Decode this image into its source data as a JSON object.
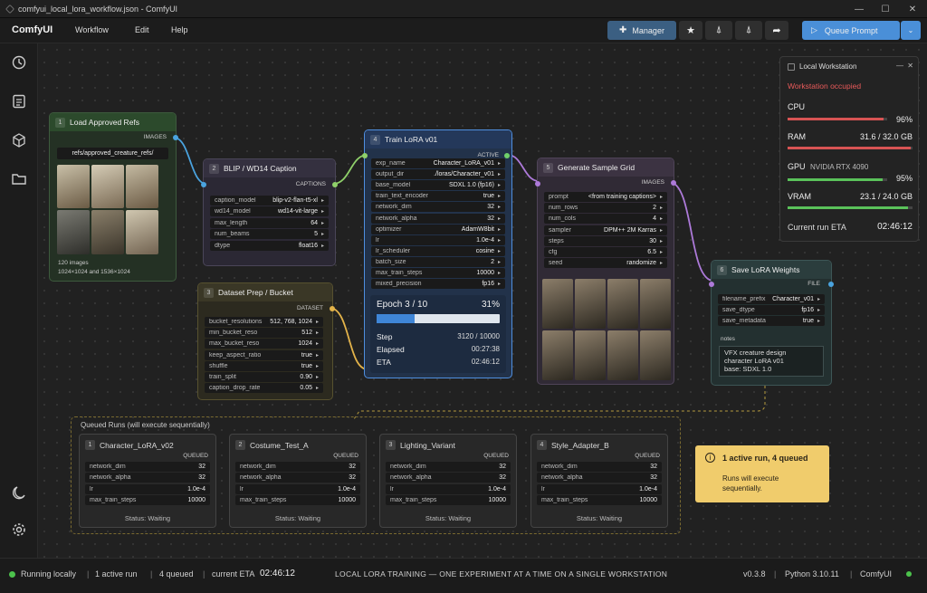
{
  "window": {
    "title": "comfyui_local_lora_workflow.json - ComfyUI"
  },
  "menubar": {
    "logo": "ComfyUI",
    "items": [
      "Workflow",
      "Edit",
      "Help"
    ],
    "manager": "Manager",
    "queue": "Queue Prompt"
  },
  "nodes": {
    "refs": {
      "num": "1",
      "title": "Load Approved Refs",
      "out": "IMAGES",
      "path": "refs/approved_creature_refs/",
      "count": "120 images",
      "sizes": "1024×1024 and 1536×1024"
    },
    "caption": {
      "num": "2",
      "title": "BLIP / WD14 Caption",
      "out": "CAPTIONS",
      "rows": [
        [
          "caption_model",
          "blip-v2-flan-t5-xl"
        ],
        [
          "wd14_model",
          "wd14-vit-large"
        ],
        [
          "max_length",
          "64"
        ],
        [
          "num_beams",
          "5"
        ],
        [
          "dtype",
          "float16"
        ]
      ]
    },
    "prep": {
      "num": "3",
      "title": "Dataset Prep / Bucket",
      "out": "DATASET",
      "rows": [
        [
          "bucket_resolutions",
          "512, 768, 1024"
        ],
        [
          "min_bucket_reso",
          "512"
        ],
        [
          "max_bucket_reso",
          "1024"
        ],
        [
          "keep_aspect_ratio",
          "true"
        ],
        [
          "shuffle",
          "true"
        ],
        [
          "train_split",
          "0.90"
        ],
        [
          "caption_drop_rate",
          "0.05"
        ]
      ]
    },
    "train": {
      "num": "4",
      "title": "Train LoRA v01",
      "out": "ACTIVE",
      "rows": [
        [
          "exp_name",
          "Character_LoRA_v01"
        ],
        [
          "output_dir",
          "./loras/Character_v01"
        ],
        [
          "base_model",
          "SDXL 1.0 (fp16)"
        ],
        [
          "train_text_encoder",
          "true"
        ],
        [
          "network_dim",
          "32"
        ],
        [
          "network_alpha",
          "32"
        ],
        [
          "optimizer",
          "AdamW8bit"
        ],
        [
          "lr",
          "1.0e-4"
        ],
        [
          "lr_scheduler",
          "cosine"
        ],
        [
          "batch_size",
          "2"
        ],
        [
          "max_train_steps",
          "10000"
        ],
        [
          "mixed_precision",
          "fp16"
        ]
      ],
      "epoch": "Epoch 3 / 10",
      "pct": "31%",
      "progress": 0.31,
      "stats": [
        [
          "Step",
          "3120 / 10000"
        ],
        [
          "Elapsed",
          "00:27:38"
        ],
        [
          "ETA",
          "02:46:12"
        ]
      ]
    },
    "sample": {
      "num": "5",
      "title": "Generate Sample Grid",
      "out": "IMAGES",
      "rows": [
        [
          "prompt",
          "<from training captions>"
        ],
        [
          "num_rows",
          "2"
        ],
        [
          "num_cols",
          "4"
        ],
        [
          "sampler",
          "DPM++ 2M Karras"
        ],
        [
          "steps",
          "30"
        ],
        [
          "cfg",
          "6.5"
        ],
        [
          "seed",
          "randomize"
        ]
      ]
    },
    "save": {
      "num": "6",
      "title": "Save LoRA Weights",
      "out": "FILE",
      "rows": [
        [
          "filename_prefix",
          "Character_v01"
        ],
        [
          "save_dtype",
          "fp16"
        ],
        [
          "save_metadata",
          "true"
        ]
      ],
      "notes_label": "notes",
      "notes": [
        "VFX creature design",
        "character LoRA v01",
        "base: SDXL 1.0"
      ]
    }
  },
  "workstation": {
    "title": "Local Workstation",
    "status": "Workstation occupied",
    "cpu_label": "CPU",
    "cpu": "96%",
    "cpu_frac": 0.96,
    "ram_label": "RAM",
    "ram": "31.6 / 32.0 GB",
    "ram_frac": 0.9875,
    "gpu_label": "GPU",
    "gpu_name": "NVIDIA RTX 4090",
    "gpu": "95%",
    "gpu_frac": 0.95,
    "vram_label": "VRAM",
    "vram": "23.1 / 24.0 GB",
    "vram_frac": 0.9625,
    "eta_label": "Current run ETA",
    "eta": "02:46:12"
  },
  "queue": {
    "title": "Queued Runs (will execute sequentially)",
    "tag": "QUEUED",
    "runs": [
      {
        "num": "1",
        "name": "Character_LoRA_v02",
        "rows": [
          [
            "network_dim",
            "32"
          ],
          [
            "network_alpha",
            "32"
          ],
          [
            "lr",
            "1.0e-4"
          ],
          [
            "max_train_steps",
            "10000"
          ]
        ],
        "status": "Status:  Waiting"
      },
      {
        "num": "2",
        "name": "Costume_Test_A",
        "rows": [
          [
            "network_dim",
            "32"
          ],
          [
            "network_alpha",
            "32"
          ],
          [
            "lr",
            "1.0e-4"
          ],
          [
            "max_train_steps",
            "10000"
          ]
        ],
        "status": "Status:  Waiting"
      },
      {
        "num": "3",
        "name": "Lighting_Variant",
        "rows": [
          [
            "network_dim",
            "32"
          ],
          [
            "network_alpha",
            "32"
          ],
          [
            "lr",
            "1.0e-4"
          ],
          [
            "max_train_steps",
            "10000"
          ]
        ],
        "status": "Status:  Waiting"
      },
      {
        "num": "4",
        "name": "Style_Adapter_B",
        "rows": [
          [
            "network_dim",
            "32"
          ],
          [
            "network_alpha",
            "32"
          ],
          [
            "lr",
            "1.0e-4"
          ],
          [
            "max_train_steps",
            "10000"
          ]
        ],
        "status": "Status:  Waiting"
      }
    ]
  },
  "notice": {
    "title": "1 active run, 4 queued",
    "body": "Runs will execute sequentially."
  },
  "status": {
    "running": "Running locally",
    "active": "1 active run",
    "queued": "4 queued",
    "eta_label": "current ETA",
    "eta": "02:46:12",
    "center": "LOCAL LORA TRAINING — ONE EXPERIMENT AT A TIME ON A SINGLE WORKSTATION",
    "version": "v0.3.8",
    "python": "Python 3.10.11",
    "app": "ComfyUI"
  }
}
